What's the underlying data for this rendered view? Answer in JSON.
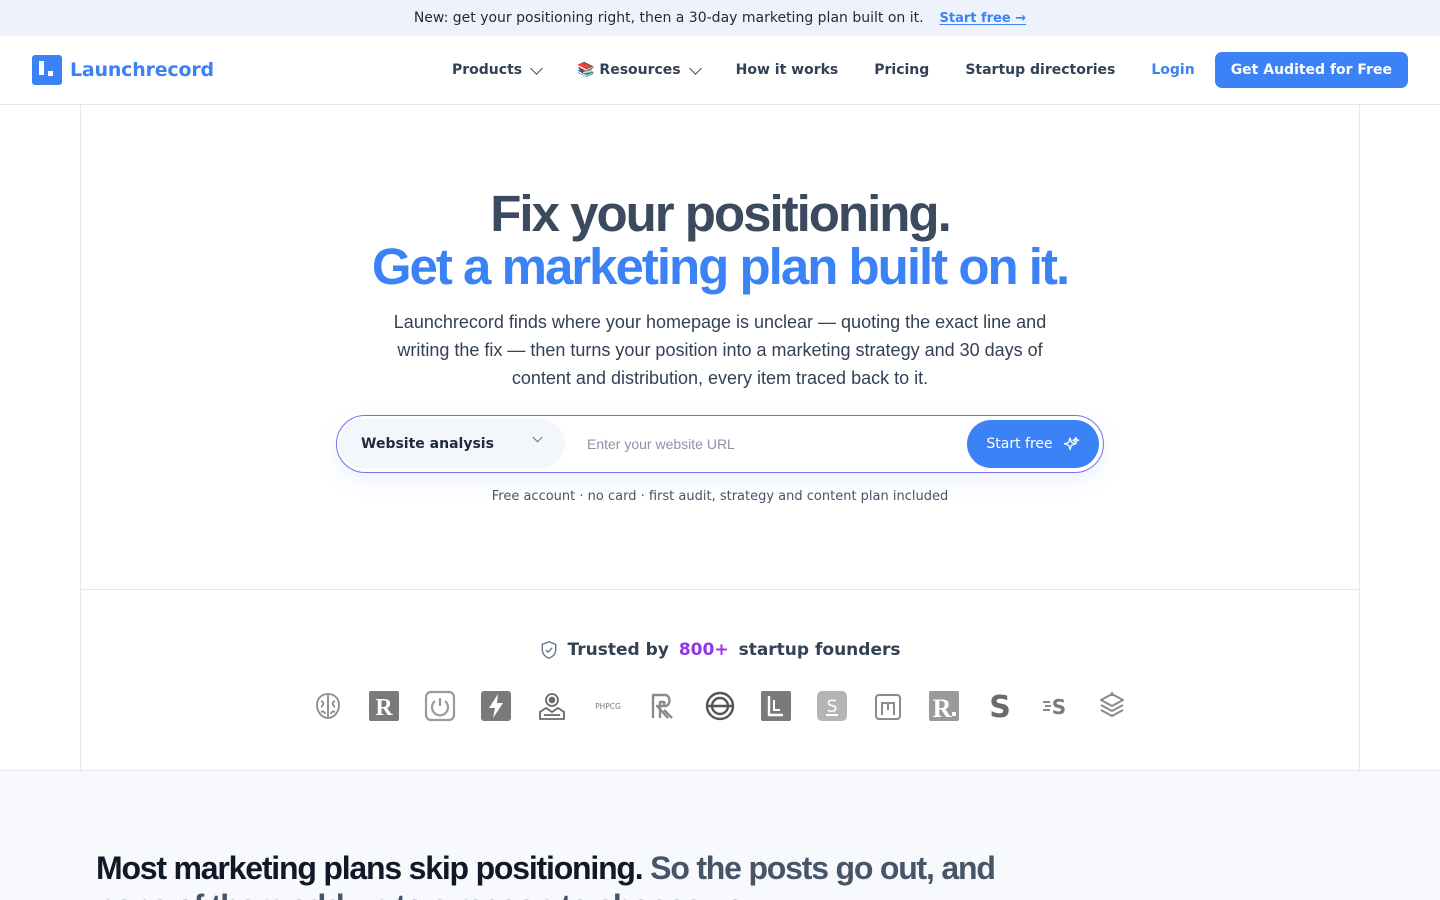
{
  "announcement": {
    "text": "New: get your positioning right, then a 30-day marketing plan built on it.",
    "link_label": "Start free →"
  },
  "header": {
    "brand": "Launchrecord",
    "nav": {
      "products": "Products",
      "resources": "📚 Resources",
      "how_it_works": "How it works",
      "pricing": "Pricing",
      "directories": "Startup directories",
      "login": "Login",
      "cta": "Get Audited for Free"
    }
  },
  "hero": {
    "title_line1": "Fix your positioning.",
    "title_line2": "Get a marketing plan built on it.",
    "subtitle": "Launchrecord finds where your homepage is unclear — quoting the exact line and writing the fix — then turns your position into a marketing strategy and 30 days of content and distribution, every item traced back to it.",
    "search": {
      "mode_selected": "Website analysis",
      "placeholder": "Enter your website URL",
      "button": "Start free"
    },
    "note": "Free account · no card · first audit, strategy and content plan included"
  },
  "trusted": {
    "prefix": "Trusted by",
    "count": "800+",
    "suffix": "startup founders",
    "logos": [
      "brain-logo",
      "r-logo",
      "power-logo",
      "bolt-logo",
      "map-pin-logo",
      "phpcg-logo",
      "rr-logo",
      "globe-logo",
      "bracket-logo",
      "s-box-logo",
      "m-logo",
      "rdot-logo",
      "s-logo",
      "speed-s-logo",
      "stack-logo"
    ],
    "phpcg_text": "PHPCG"
  },
  "section2": {
    "heading_dark": "Most marketing plans skip positioning.",
    "heading_muted": "So the posts go out, and none of them add up to a reason to choose you."
  },
  "colors": {
    "accent": "#3b82f6",
    "highlight": "#9333ea"
  }
}
